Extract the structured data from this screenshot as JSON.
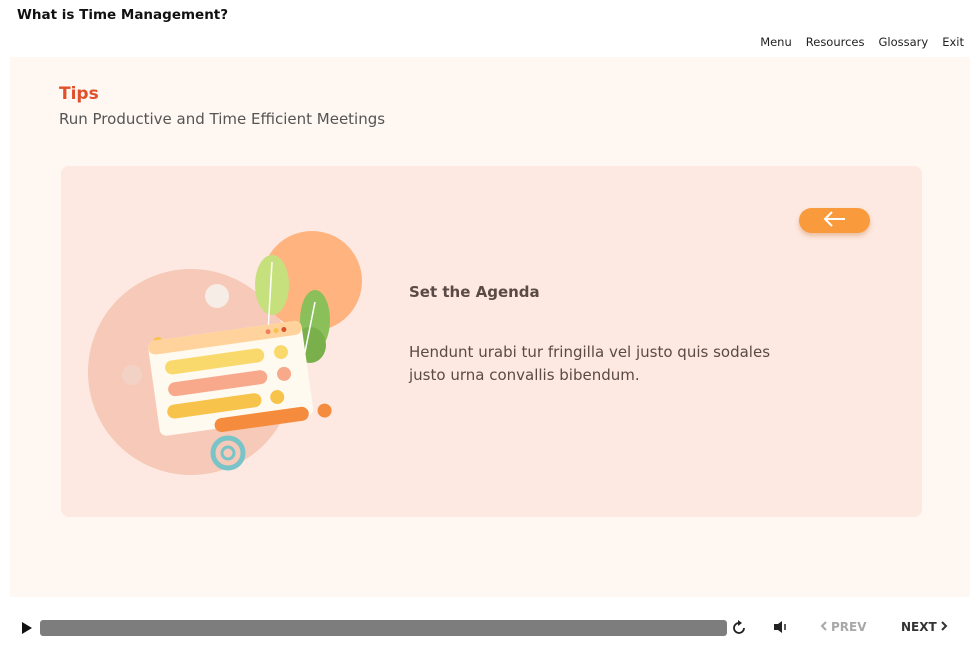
{
  "header": {
    "title": "What is Time Management?",
    "nav": [
      "Menu",
      "Resources",
      "Glossary",
      "Exit"
    ]
  },
  "slide": {
    "section": "Tips",
    "subtitle": "Run Productive and Time Efficient Meetings",
    "card": {
      "heading": "Set the Agenda",
      "body": "Hendunt urabi tur fringilla vel justo quis sodales justo urna convallis bibendum.",
      "back_icon": "arrow-left-icon"
    }
  },
  "player": {
    "progress": 1.0,
    "prev_label": "PREV",
    "next_label": "NEXT",
    "prev_enabled": false,
    "icons": [
      "play-icon",
      "replay-icon",
      "volume-icon",
      "chevron-left-icon",
      "chevron-right-icon"
    ]
  },
  "colors": {
    "accent": "#e0502a",
    "button": "#f99a3c",
    "card_bg": "#fde9e1",
    "stage_bg": "#fff7f2"
  }
}
